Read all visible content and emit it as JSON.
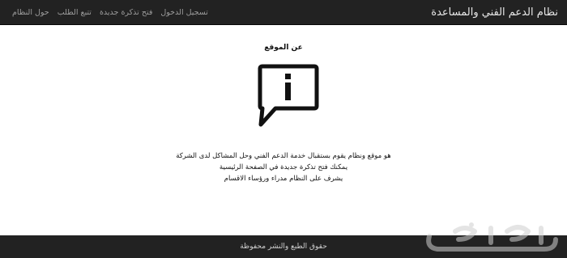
{
  "navbar": {
    "brand": "نظام الدعم الفني والمساعدة",
    "links": [
      {
        "label": "تسجيل الدخول"
      },
      {
        "label": "فتح تذكرة جديدة"
      },
      {
        "label": "تتبع الطلب"
      },
      {
        "label": "حول النظام"
      }
    ]
  },
  "main": {
    "title": "عن الموقع",
    "icon": "info-speech-bubble-icon",
    "lines": [
      "هو موقع ونظام يقوم بستقبال خدمة الدعم الفني وحل المشاكل لدى الشركة",
      "يمكنك فتح تذكرة جديدة في الصفحة الرئيسية",
      "يشرف على النظام مدراء ورؤساء الاقسام"
    ]
  },
  "footer": {
    "text": "حقوق الطبع والنشر محفوظة"
  },
  "watermark": {
    "text": "حراج",
    "icon": "haraj-watermark-logo"
  },
  "colors": {
    "navbar_bg": "#222222",
    "brand_text": "#e8e8e8",
    "nav_link_text": "#9d9d9d",
    "page_bg": "#ffffff",
    "footer_bg": "#222222",
    "footer_text": "#d0d0d0"
  }
}
